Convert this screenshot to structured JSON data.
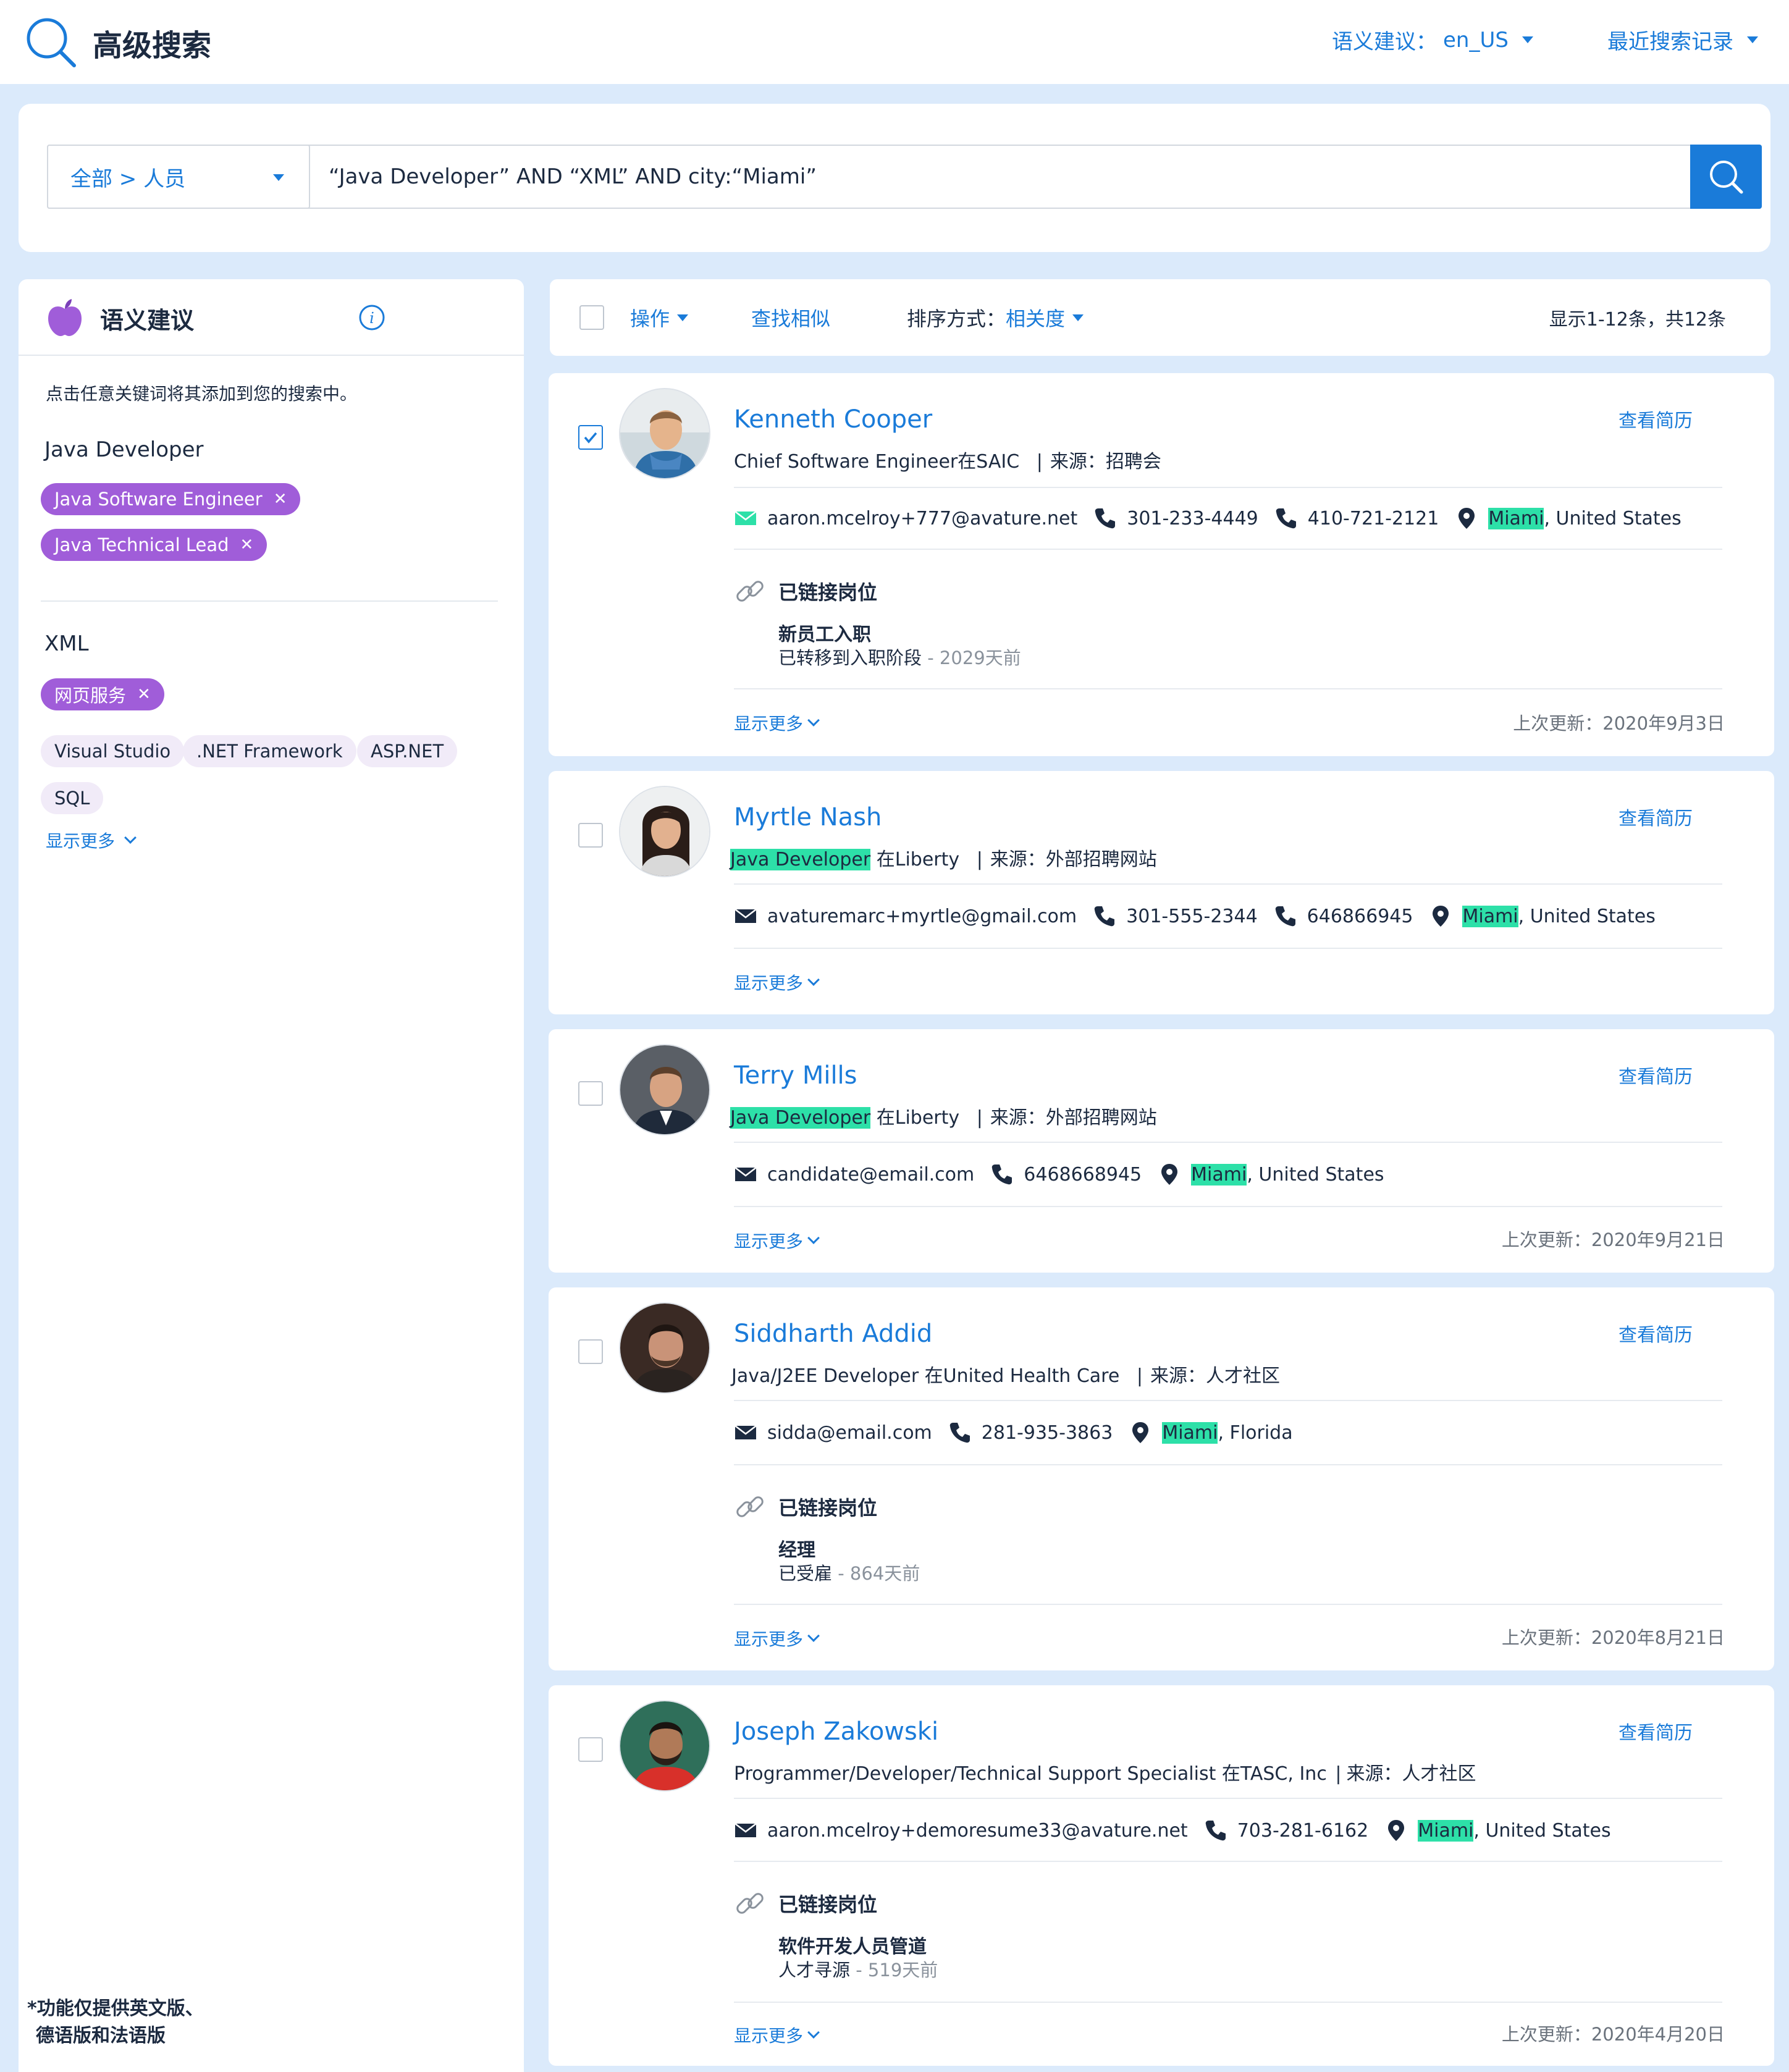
{
  "header": {
    "title": "高级搜索",
    "semantic_label": "语义建议：",
    "semantic_value": "en_US",
    "recent": "最近搜索记录"
  },
  "search": {
    "scope": "全部 > 人员",
    "query": "“Java Developer” AND “XML” AND city:“Miami”"
  },
  "sidebar": {
    "title": "语义建议",
    "description": "点击任意关键词将其添加到您的搜索中。",
    "group1": {
      "title": "Java Developer",
      "chips": [
        "Java Software Engineer",
        "Java Technical Lead"
      ]
    },
    "group2": {
      "title": "XML",
      "active_chips": [
        "网页服务"
      ],
      "chips": [
        "Visual Studio",
        ".NET Framework",
        "ASP.NET",
        "SQL"
      ]
    },
    "show_more": "显示更多",
    "footnote_line1": "*功能仅提供英文版、",
    "footnote_line2": "德语版和法语版"
  },
  "toolbar": {
    "actions": "操作",
    "find_similar": "查找相似",
    "sort_label": "排序方式：",
    "sort_value": "相关度",
    "count": "显示1-12条，共12条"
  },
  "common": {
    "view_resume": "查看简历",
    "show_more": "显示更多",
    "linked_jobs": "已链接岗位",
    "source_label": "来源：",
    "sep": "|"
  },
  "candidates": [
    {
      "name": "Kenneth Cooper",
      "title_plain": "Chief Software Engineer在SAIC",
      "title_hl": "",
      "title_rest": "",
      "source": "招聘会",
      "email": "aaron.mcelroy+777@avature.net",
      "phone1": "301-233-4449",
      "phone2": "410-721-2121",
      "city": "Miami",
      "region": ", United States",
      "linked_job": "新员工入职",
      "linked_stage": "已转移到入职阶段",
      "linked_ago": " - 2029天前",
      "updated": "上次更新：2020年9月3日",
      "checked": true
    },
    {
      "name": "Myrtle Nash",
      "title_hl": "Java Developer",
      "title_rest": " 在Liberty",
      "source": "外部招聘网站",
      "email": "avaturemarc+myrtle@gmail.com",
      "phone1": "301-555-2344",
      "phone2": "646866945",
      "city": "Miami",
      "region": ", United States"
    },
    {
      "name": "Terry Mills",
      "title_hl": "Java Developer",
      "title_rest": " 在Liberty",
      "source": "外部招聘网站",
      "email": "candidate@email.com",
      "phone1": "6468668945",
      "city": "Miami",
      "region": ", United States",
      "updated": "上次更新：2020年9月21日"
    },
    {
      "name": "Siddharth Addid",
      "title_plain": "Java/J2EE Developer 在United Health Care",
      "source": "人才社区",
      "email": "sidda@email.com",
      "phone1": "281-935-3863",
      "city": "Miami",
      "region": ", Florida",
      "linked_job": "经理",
      "linked_stage": "已受雇",
      "linked_ago": " - 864天前",
      "updated": "上次更新：2020年8月21日"
    },
    {
      "name": "Joseph Zakowski",
      "title_plain": "Programmer/Developer/Technical Support Specialist 在TASC, Inc",
      "source": "人才社区",
      "email": "aaron.mcelroy+demoresume33@avature.net",
      "phone1": "703-281-6162",
      "city": "Miami",
      "region": ", United States",
      "linked_job": "软件开发人员管道",
      "linked_stage": "人才寻源",
      "linked_ago": " - 519天前",
      "updated": "上次更新：2020年4月20日"
    }
  ],
  "colors": {
    "accent": "#1a7bd9",
    "chip_active": "#a05dd9",
    "highlight": "#2de0a8",
    "background": "#dbeafb"
  },
  "icons": [
    "search-icon",
    "apple-icon",
    "info-icon",
    "email-icon",
    "phone-icon",
    "location-pin-icon",
    "link-icon",
    "chevron-down-icon",
    "caret-down-icon",
    "check-icon"
  ]
}
